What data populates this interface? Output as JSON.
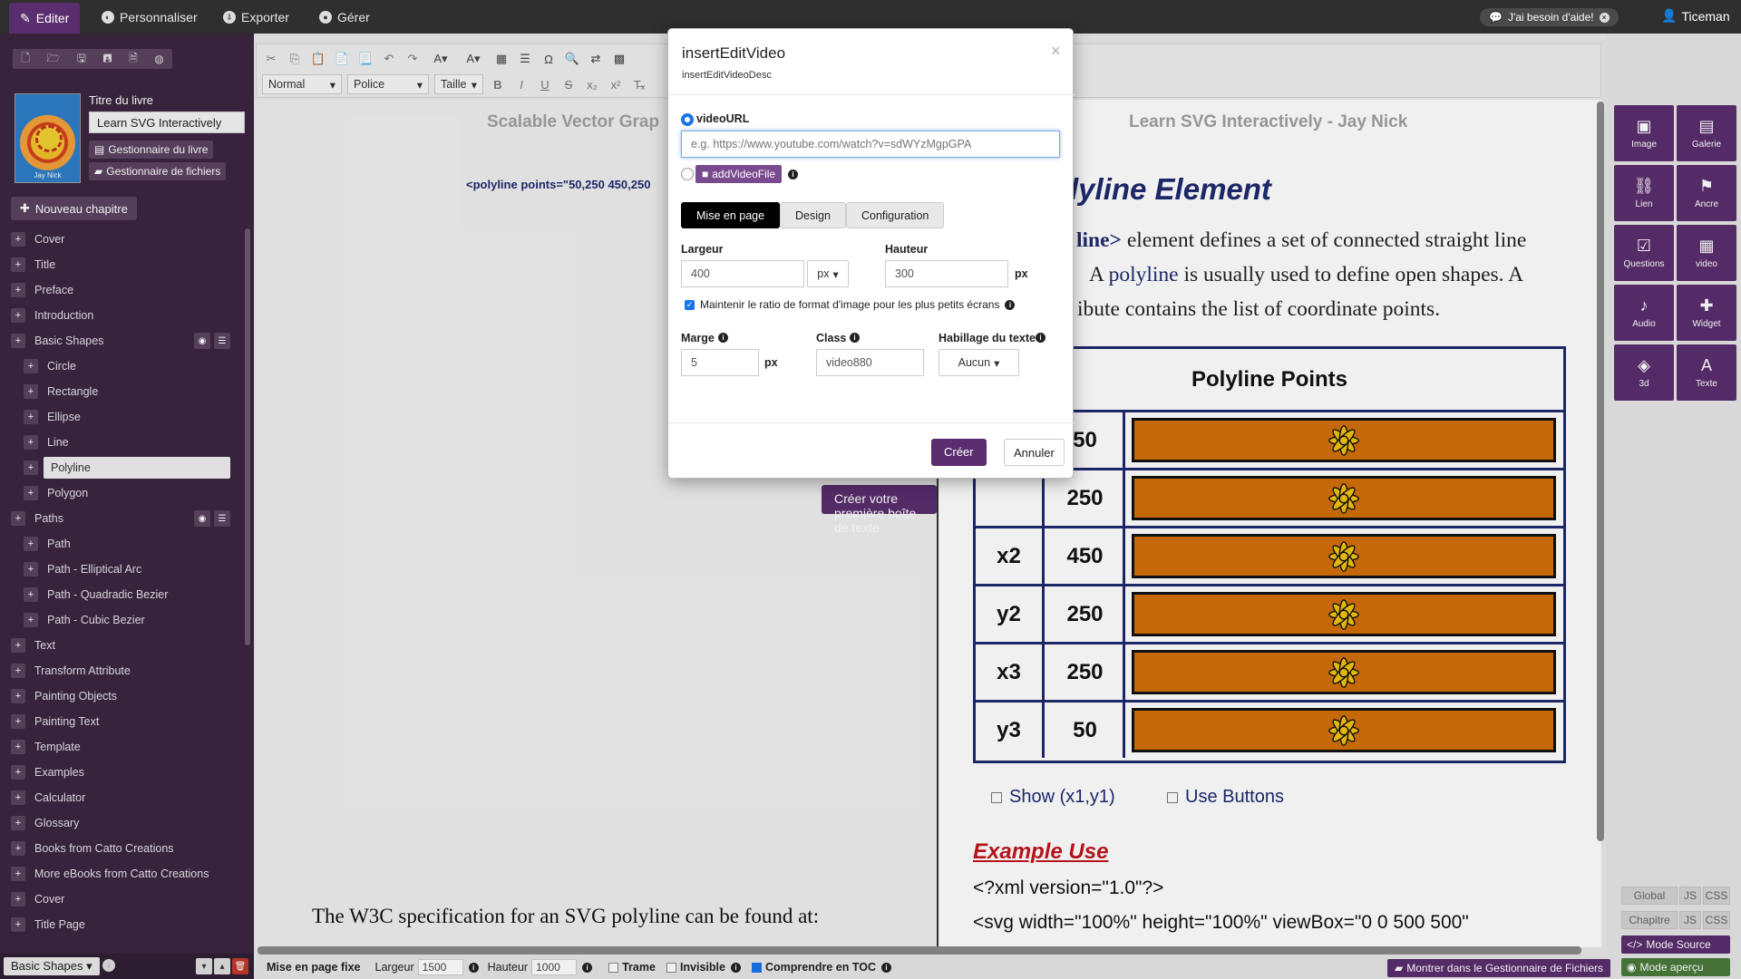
{
  "topbar": {
    "tabs": [
      {
        "label": "Editer",
        "icon": "pencil-icon"
      },
      {
        "label": "Personnaliser",
        "icon": "palette-icon"
      },
      {
        "label": "Exporter",
        "icon": "export-icon"
      },
      {
        "label": "Gérer",
        "icon": "user-circle-icon"
      }
    ],
    "help_label": "J'ai besoin d'aide!",
    "user_name": "Ticeman"
  },
  "sidebar": {
    "book_title_label": "Titre du livre",
    "book_title_value": "Learn SVG Interactively",
    "cover_caption": "Jay Nick",
    "book_manager": "Gestionnaire du livre",
    "file_manager": "Gestionnaire de fichiers",
    "new_chapter": "Nouveau chapitre",
    "items": [
      {
        "label": "Cover",
        "level": 0
      },
      {
        "label": "Title",
        "level": 0
      },
      {
        "label": "Preface",
        "level": 0
      },
      {
        "label": "Introduction",
        "level": 0
      },
      {
        "label": "Basic Shapes",
        "level": 0,
        "tools": true
      },
      {
        "label": "Circle",
        "level": 1
      },
      {
        "label": "Rectangle",
        "level": 1
      },
      {
        "label": "Ellipse",
        "level": 1
      },
      {
        "label": "Line",
        "level": 1
      },
      {
        "label": "Polyline",
        "level": 1,
        "selected": true
      },
      {
        "label": "Polygon",
        "level": 1
      },
      {
        "label": "Paths",
        "level": 0,
        "tools": true
      },
      {
        "label": "Path",
        "level": 1
      },
      {
        "label": "Path - Elliptical Arc",
        "level": 1
      },
      {
        "label": "Path - Quadradic Bezier",
        "level": 1
      },
      {
        "label": "Path - Cubic Bezier",
        "level": 1
      },
      {
        "label": "Text",
        "level": 0
      },
      {
        "label": "Transform Attribute",
        "level": 0
      },
      {
        "label": "Painting Objects",
        "level": 0
      },
      {
        "label": "Painting Text",
        "level": 0
      },
      {
        "label": "Template",
        "level": 0
      },
      {
        "label": "Examples",
        "level": 0
      },
      {
        "label": "Calculator",
        "level": 0
      },
      {
        "label": "Glossary",
        "level": 0
      },
      {
        "label": "Books from Catto Creations",
        "level": 0
      },
      {
        "label": "More eBooks from Catto Creations",
        "level": 0
      },
      {
        "label": "Cover",
        "level": 0
      },
      {
        "label": "Title Page",
        "level": 0
      }
    ],
    "bottom_select": "Basic Shapes"
  },
  "toolbar": {
    "format": "Normal",
    "font": "Police",
    "size": "Taille"
  },
  "page": {
    "left_header": "Scalable Vector Grap",
    "left_code": "<polyline points=\"50,250 450,250",
    "left_footer": "The W3C specification for an SVG polyline can be found at:",
    "first_box_button": "Créer votre première boîte de texte",
    "right_header": "Learn SVG Interactively - Jay Nick",
    "title": "lyline Element",
    "para_line1_bold": "line>",
    "para_line1_rest": " element defines a set of connected straight line",
    "para_line2_pre": "A ",
    "para_line2_link": "polyline",
    "para_line2_rest": " is usually used to define open shapes. A",
    "para_line3": "ibute contains the list of coordinate points.",
    "table_title": "Polyline Points",
    "rows": [
      {
        "key": "",
        "value": "50"
      },
      {
        "key": "",
        "value": "250"
      },
      {
        "key": "x2",
        "value": "450"
      },
      {
        "key": "y2",
        "value": "250"
      },
      {
        "key": "x3",
        "value": "250"
      },
      {
        "key": "y3",
        "value": "50"
      }
    ],
    "show_label": "Show (x1,y1)",
    "use_buttons_label": "Use Buttons",
    "example_use": "Example Use",
    "code1": "<?xml version=\"1.0\"?>",
    "code2": "<svg width=\"100%\" height=\"100%\" viewBox=\"0 0 500 500\""
  },
  "rpanel": {
    "tiles": [
      {
        "label": "Image",
        "glyph": "▣"
      },
      {
        "label": "Galerie",
        "glyph": "▤"
      },
      {
        "label": "Lien",
        "glyph": "⛓"
      },
      {
        "label": "Ancre",
        "glyph": "⚑"
      },
      {
        "label": "Questions",
        "glyph": "☑"
      },
      {
        "label": "video",
        "glyph": "▦"
      },
      {
        "label": "Audio",
        "glyph": "♪"
      },
      {
        "label": "Widget",
        "glyph": "✚"
      },
      {
        "label": "3d",
        "glyph": "◈"
      },
      {
        "label": "Texte",
        "glyph": "A"
      }
    ],
    "global": "Global",
    "chapitre": "Chapitre",
    "js": "JS",
    "css": "CSS",
    "mode_source": "Mode Source",
    "mode_apercu": "Mode aperçu"
  },
  "statusbar": {
    "fixed_layout": "Mise en page fixe",
    "width_label": "Largeur",
    "width_value": "1500",
    "height_label": "Hauteur",
    "height_value": "1000",
    "grid": "Trame",
    "invisible": "Invisible",
    "toc": "Comprendre en TOC",
    "show_in_files": "Montrer dans le Gestionnaire de Fichiers"
  },
  "modal": {
    "title": "insertEditVideo",
    "desc": "insertEditVideoDesc",
    "video_url_label": "videoURL",
    "video_url_placeholder": "e.g. https://www.youtube.com/watch?v=sdWYzMgpGPA",
    "add_video_file": "addVideoFile",
    "tabs": [
      "Mise en page",
      "Design",
      "Configuration"
    ],
    "width_label": "Largeur",
    "width_value": "400",
    "width_unit": "px",
    "height_label": "Hauteur",
    "height_value": "300",
    "height_unit": "px",
    "keep_ratio": "Maintenir le ratio de format d'image pour les plus petits écrans",
    "margin_label": "Marge",
    "margin_value": "5",
    "margin_unit": "px",
    "class_label": "Class",
    "class_value": "video880",
    "wrap_label": "Habillage du texte",
    "wrap_value": "Aucun",
    "create": "Créer",
    "cancel": "Annuler"
  }
}
